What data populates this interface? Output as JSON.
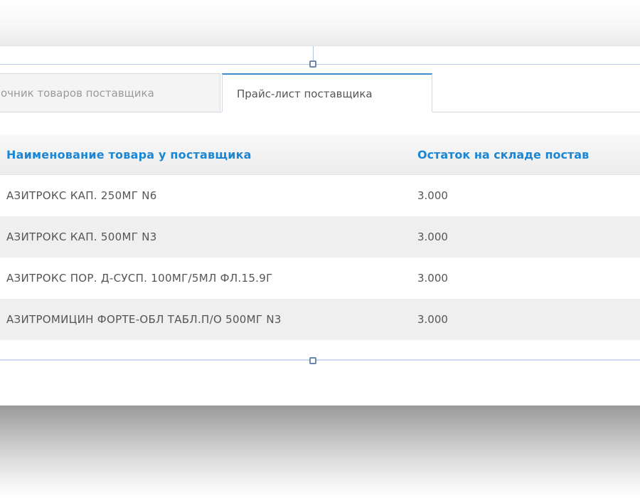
{
  "tabs": [
    {
      "label": "очник товаров поставщика",
      "active": false
    },
    {
      "label": "Прайс-лист поставщика",
      "active": true
    }
  ],
  "table": {
    "columns": [
      "Наименование товара у поставщика",
      "Остаток на складе постав"
    ],
    "rows": [
      {
        "name": "АЗИТРОКС КАП. 250МГ N6",
        "stock": "3.000"
      },
      {
        "name": "АЗИТРОКС КАП. 500МГ N3",
        "stock": "3.000"
      },
      {
        "name": "АЗИТРОКС ПОР. Д-СУСП. 100МГ/5МЛ ФЛ.15.9Г",
        "stock": "3.000"
      },
      {
        "name": "АЗИТРОМИЦИН ФОРТЕ-ОБЛ ТАБЛ.П/О 500МГ N3",
        "stock": "3.000"
      }
    ]
  },
  "colors": {
    "accent": "#1a86d4",
    "active_tab_border": "#3d8ed8",
    "text": "#555555"
  }
}
